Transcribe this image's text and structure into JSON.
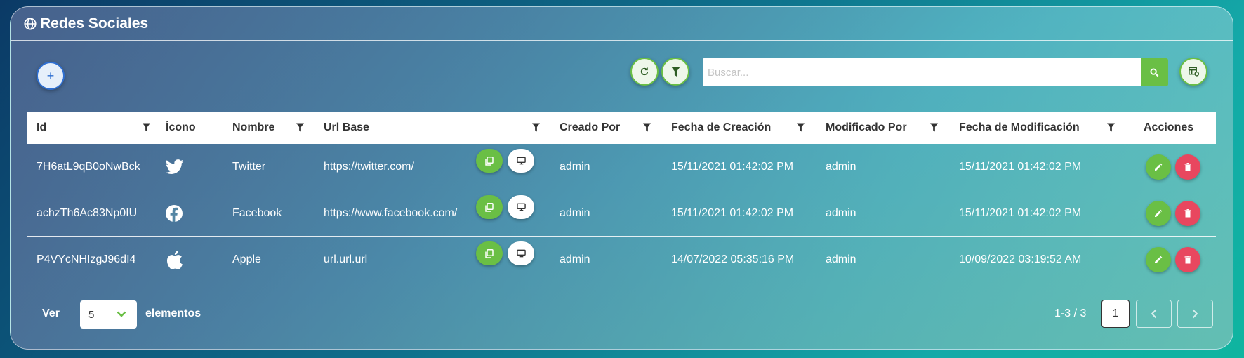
{
  "card": {
    "title": "Redes Sociales"
  },
  "toolbar": {
    "add_label": "+",
    "search_placeholder": "Buscar..."
  },
  "table": {
    "headers": {
      "id": "Id",
      "icono": "Ícono",
      "nombre": "Nombre",
      "url_base": "Url Base",
      "creado_por": "Creado Por",
      "fecha_creacion": "Fecha de Creación",
      "modificado_por": "Modificado Por",
      "fecha_modificacion": "Fecha de Modificación",
      "acciones": "Acciones"
    },
    "rows": [
      {
        "id": "7H6atL9qB0oNwBck",
        "icon": "twitter-icon",
        "nombre": "Twitter",
        "url": "https://twitter.com/",
        "creado_por": "admin",
        "fecha_creacion": "15/11/2021 01:42:02 PM",
        "modificado_por": "admin",
        "fecha_modificacion": "15/11/2021 01:42:02 PM"
      },
      {
        "id": "achzTh6Ac83Np0IU",
        "icon": "facebook-icon",
        "nombre": "Facebook",
        "url": "https://www.facebook.com/",
        "creado_por": "admin",
        "fecha_creacion": "15/11/2021 01:42:02 PM",
        "modificado_por": "admin",
        "fecha_modificacion": "15/11/2021 01:42:02 PM"
      },
      {
        "id": "P4VYcNHIzgJ96dI4",
        "icon": "apple-icon",
        "nombre": "Apple",
        "url": "url.url.url",
        "creado_por": "admin",
        "fecha_creacion": "14/07/2022 05:35:16 PM",
        "modificado_por": "admin",
        "fecha_modificacion": "10/09/2022 03:19:52 AM"
      }
    ]
  },
  "footer": {
    "ver_label": "Ver",
    "page_size": "5",
    "elementos_label": "elementos",
    "page_info": "1-3 / 3",
    "current_page": "1"
  },
  "colors": {
    "accent_green": "#6abf45",
    "danger_red": "#e8475f",
    "primary_blue": "#2f6fd1"
  }
}
